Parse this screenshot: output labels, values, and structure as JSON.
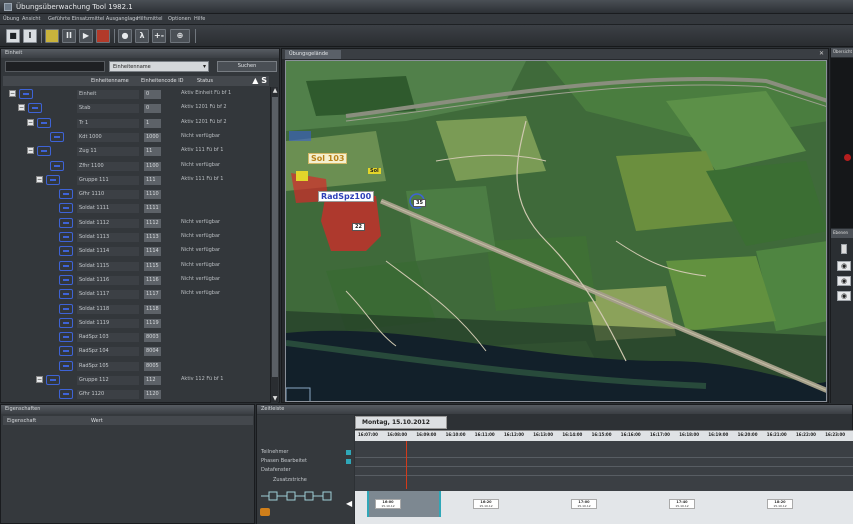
{
  "window": {
    "title": "Übungsüberwachung Tool 1982.1"
  },
  "menu": [
    "Übung",
    "Ansicht",
    "Geführte Einsatzmittel Ausganglage",
    "Hilfsmittel",
    "Optionen",
    "Hilfe"
  ],
  "toolbar": {
    "buttons": [
      "■",
      "I",
      "",
      "II",
      "▶",
      "",
      "●",
      "λ",
      "+-",
      "⊕"
    ]
  },
  "leftPanel": {
    "title": "Einheit",
    "filter_value": "Einheitenname",
    "search_button": "Suchen",
    "columns": [
      "Einheitenname",
      "Einheitencode ID",
      "Status"
    ],
    "sort_icons": "▲ S",
    "rows": [
      {
        "indent": 0,
        "expander": "−",
        "name": "Einheit",
        "code": "0",
        "status": "Aktiv Einheit Fü bf 1"
      },
      {
        "indent": 1,
        "expander": "−",
        "name": "Stab",
        "code": "0",
        "status": "Aktiv 1201 Fü bf 2"
      },
      {
        "indent": 2,
        "expander": "−",
        "name": "Tr 1",
        "code": "1",
        "status": "Aktiv 1201 Fü bf 2"
      },
      {
        "indent": 3,
        "expander": "",
        "name": "Kdt 1000",
        "code": "1000",
        "status": "Nicht verfügbar"
      },
      {
        "indent": 2,
        "expander": "−",
        "name": "Zug 11",
        "code": "11",
        "status": "Aktiv 111 Fü bf 1"
      },
      {
        "indent": 3,
        "expander": "",
        "name": "Zfhr 1100",
        "code": "1100",
        "status": "Nicht verfügbar"
      },
      {
        "indent": 3,
        "expander": "−",
        "name": "Gruppe 111",
        "code": "111",
        "status": "Aktiv 111 Fü bf 1"
      },
      {
        "indent": 4,
        "expander": "",
        "name": "Gfhr 1110",
        "code": "1110",
        "status": ""
      },
      {
        "indent": 4,
        "expander": "",
        "name": "Soldat 1111",
        "code": "1111",
        "status": ""
      },
      {
        "indent": 4,
        "expander": "",
        "name": "Soldat 1112",
        "code": "1112",
        "status": "Nicht verfügbar"
      },
      {
        "indent": 4,
        "expander": "",
        "name": "Soldat 1113",
        "code": "1113",
        "status": "Nicht verfügbar"
      },
      {
        "indent": 4,
        "expander": "",
        "name": "Soldat 1114",
        "code": "1114",
        "status": "Nicht verfügbar"
      },
      {
        "indent": 4,
        "expander": "",
        "name": "Soldat 1115",
        "code": "1115",
        "status": "Nicht verfügbar"
      },
      {
        "indent": 4,
        "expander": "",
        "name": "Soldat 1116",
        "code": "1116",
        "status": "Nicht verfügbar"
      },
      {
        "indent": 4,
        "expander": "",
        "name": "Soldat 1117",
        "code": "1117",
        "status": "Nicht verfügbar"
      },
      {
        "indent": 4,
        "expander": "",
        "name": "Soldat 1118",
        "code": "1118",
        "status": ""
      },
      {
        "indent": 4,
        "expander": "",
        "name": "Soldat 1119",
        "code": "1119",
        "status": ""
      },
      {
        "indent": 4,
        "expander": "",
        "name": "RadSpz 103",
        "code": "8003",
        "status": ""
      },
      {
        "indent": 4,
        "expander": "",
        "name": "RadSpz 104",
        "code": "8004",
        "status": ""
      },
      {
        "indent": 4,
        "expander": "",
        "name": "RadSpz 105",
        "code": "8005",
        "status": ""
      },
      {
        "indent": 3,
        "expander": "−",
        "name": "Gruppe 112",
        "code": "112",
        "status": "Aktiv 112 Fü bf 1"
      },
      {
        "indent": 4,
        "expander": "",
        "name": "Gfhr 1120",
        "code": "1120",
        "status": ""
      }
    ]
  },
  "map": {
    "tab": "Übungsgelände",
    "labels": {
      "sol": "Sol 103",
      "radspz": "RadSpz100",
      "n35": "35",
      "n22": "22",
      "yellow": "Sol"
    }
  },
  "rightPanel": {
    "title1": "Übersicht",
    "title2": "Ebenen",
    "eyes": [
      "◉",
      "◉",
      "◉"
    ]
  },
  "properties": {
    "title": "Eigenschaften",
    "col1": "Eigenschaft",
    "col2": "Wert"
  },
  "timeline": {
    "title": "Zeitleiste",
    "lanes": [
      "Teilnehmer",
      "Phasen Bearbeitet",
      "Datafenster"
    ],
    "sublabel": "Zusatzstriche",
    "day": "Montag, 15.10.2012",
    "times": [
      "16:07:00",
      "16:08:00",
      "16:09:00",
      "16:10:00",
      "16:11:00",
      "16:12:00",
      "16:13:00",
      "16:14:00",
      "16:15:00",
      "16:16:00",
      "16:17:00",
      "16:18:00",
      "16:19:00",
      "16:20:00",
      "16:21:00",
      "16:22:00",
      "16:23:00"
    ],
    "bottom_ticks": [
      {
        "t": "16:00",
        "d": "15.10.12"
      },
      {
        "t": "16:20",
        "d": "15.10.12"
      },
      {
        "t": "17:00",
        "d": "15.10.12"
      },
      {
        "t": "17:40",
        "d": "15.10.12"
      },
      {
        "t": "18:20",
        "d": "15.10.12"
      }
    ],
    "colors": {
      "teal": "#2fa7b8",
      "cursor": "#d33a1a"
    }
  }
}
